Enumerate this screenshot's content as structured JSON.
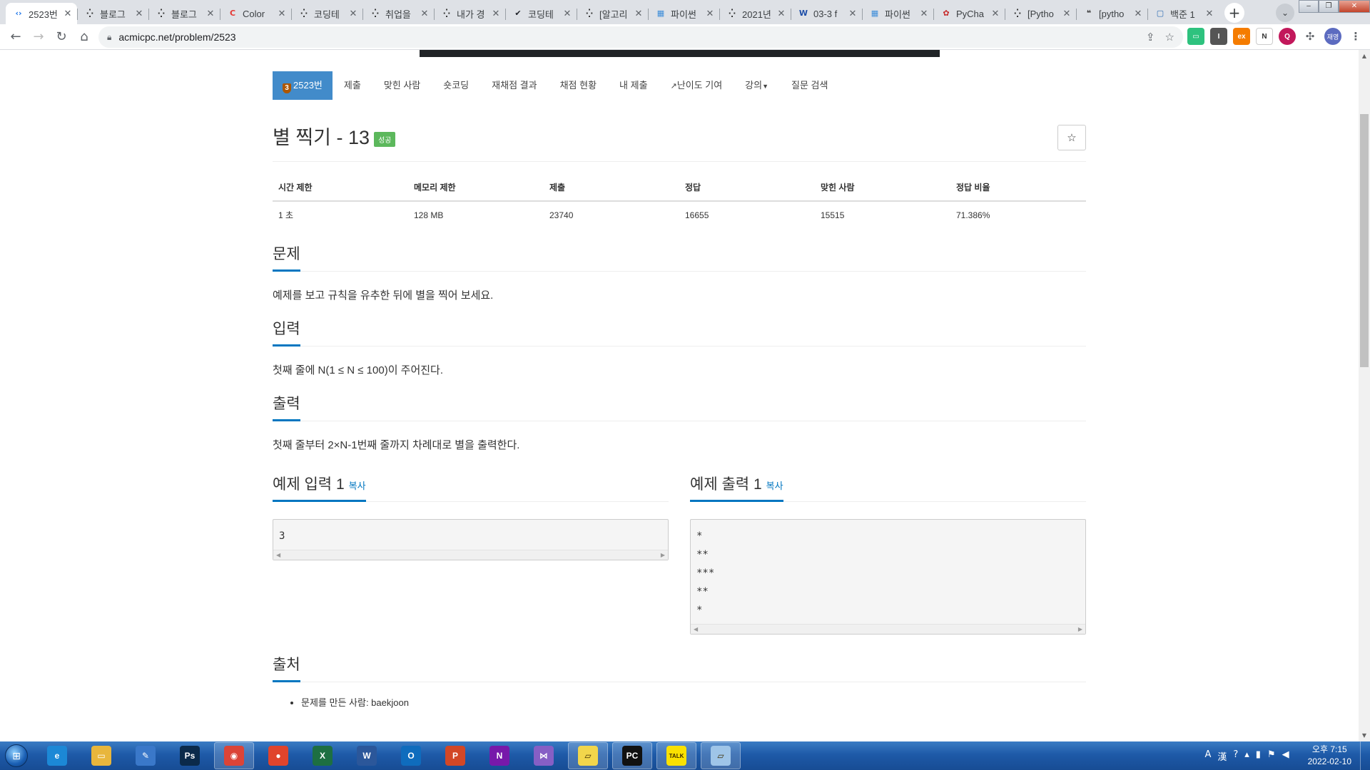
{
  "browser": {
    "tabs": [
      {
        "label": "2523번",
        "favicon": "code-icon",
        "color": "#1a73e8",
        "glyph": "‹›",
        "active": true
      },
      {
        "label": "블로그",
        "favicon": "tistory-icon",
        "color": "#333333",
        "glyph": "⁛"
      },
      {
        "label": "블로그",
        "favicon": "tistory-icon",
        "color": "#333333",
        "glyph": "⁛"
      },
      {
        "label": "Color",
        "favicon": "color-icon",
        "color": "#e53935",
        "glyph": "C"
      },
      {
        "label": "코딩테",
        "favicon": "tistory-icon",
        "color": "#333333",
        "glyph": "⁛"
      },
      {
        "label": "취업을",
        "favicon": "tistory-icon",
        "color": "#333333",
        "glyph": "⁛"
      },
      {
        "label": "내가 경",
        "favicon": "tistory-icon",
        "color": "#333333",
        "glyph": "⁛"
      },
      {
        "label": "코딩테",
        "favicon": "velog-icon",
        "color": "#20232a",
        "glyph": "✔"
      },
      {
        "label": "[알고리",
        "favicon": "tistory-icon",
        "color": "#333333",
        "glyph": "⁛"
      },
      {
        "label": "파이썬",
        "favicon": "grid-icon",
        "color": "#3c8dd9",
        "glyph": "▦"
      },
      {
        "label": "2021년",
        "favicon": "tistory-icon",
        "color": "#333333",
        "glyph": "⁛"
      },
      {
        "label": "03-3 f",
        "favicon": "wikidocs-icon",
        "color": "#1e4fa8",
        "glyph": "W"
      },
      {
        "label": "파이썬",
        "favicon": "grid-icon",
        "color": "#3c8dd9",
        "glyph": "▦"
      },
      {
        "label": "PyCha",
        "favicon": "leaf-icon",
        "color": "#c62828",
        "glyph": "✿"
      },
      {
        "label": "[Pytho",
        "favicon": "tistory-icon",
        "color": "#333333",
        "glyph": "⁛"
      },
      {
        "label": "[pytho",
        "favicon": "chat-icon",
        "color": "#333333",
        "glyph": "❝"
      },
      {
        "label": "백준 1",
        "favicon": "boj-icon",
        "color": "#2e6db4",
        "glyph": "▢"
      }
    ],
    "new_tab": "+",
    "url": "acmicpc.net/problem/2523",
    "profile_label": "재영"
  },
  "problem_nav": {
    "items": [
      "2523번",
      "제출",
      "맞힌 사람",
      "숏코딩",
      "재채점 결과",
      "채점 현황",
      "내 제출",
      "난이도 기여",
      "강의",
      "질문 검색"
    ],
    "tier": "3"
  },
  "problem": {
    "title": "별 찍기 - 13",
    "badge": "성공",
    "info_headers": [
      "시간 제한",
      "메모리 제한",
      "제출",
      "정답",
      "맞힌 사람",
      "정답 비율"
    ],
    "info_values": [
      "1 초",
      "128 MB",
      "23740",
      "16655",
      "15515",
      "71.386%"
    ],
    "sections": {
      "description_title": "문제",
      "description": "예제를 보고 규칙을 유추한 뒤에 별을 찍어 보세요.",
      "input_title": "입력",
      "input": "첫째 줄에 N(1 ≤ N ≤ 100)이 주어진다.",
      "output_title": "출력",
      "output": "첫째 줄부터 2×N-1번째 줄까지 차례대로 별을 출력한다."
    },
    "sample_input_title": "예제 입력 1",
    "sample_output_title": "예제 출력 1",
    "copy_label": "복사",
    "sample_input": "3",
    "sample_output": "*\n**\n***\n**\n*",
    "source_title": "출처",
    "source_item": "문제를 만든 사람: baekjoon"
  },
  "taskbar": {
    "apps": [
      {
        "name": "ie-icon",
        "color": "#1c88d6",
        "glyph": "e"
      },
      {
        "name": "explorer-icon",
        "color": "#e8b63c",
        "glyph": "▭"
      },
      {
        "name": "notepad-check-icon",
        "color": "#3a78c9",
        "glyph": "✎"
      },
      {
        "name": "photoshop-icon",
        "color": "#0b2a4a",
        "glyph": "Ps"
      },
      {
        "name": "chrome-icon",
        "color": "#db4437",
        "glyph": "◉",
        "running": true
      },
      {
        "name": "bandizip-icon",
        "color": "#e0442c",
        "glyph": "●"
      },
      {
        "name": "excel-icon",
        "color": "#1d6f42",
        "glyph": "X"
      },
      {
        "name": "word-icon",
        "color": "#2b579a",
        "glyph": "W"
      },
      {
        "name": "outlook-icon",
        "color": "#0f6cbd",
        "glyph": "O"
      },
      {
        "name": "powerpoint-icon",
        "color": "#d24726",
        "glyph": "P"
      },
      {
        "name": "onenote-icon",
        "color": "#7719aa",
        "glyph": "N"
      },
      {
        "name": "visual-studio-icon",
        "color": "#865fc5",
        "glyph": "⋈"
      },
      {
        "name": "sticky-notes-icon",
        "color": "#f2d64b",
        "glyph": "▱",
        "running": true
      },
      {
        "name": "pycharm-icon",
        "color": "#111111",
        "glyph": "PC",
        "running": true
      },
      {
        "name": "kakaotalk-icon",
        "color": "#fae100",
        "glyph": "TALK",
        "running": true
      },
      {
        "name": "notepad-icon",
        "color": "#9fc5e8",
        "glyph": "▱",
        "running": true
      }
    ],
    "time": "오후 7:15",
    "date": "2022-02-10"
  }
}
